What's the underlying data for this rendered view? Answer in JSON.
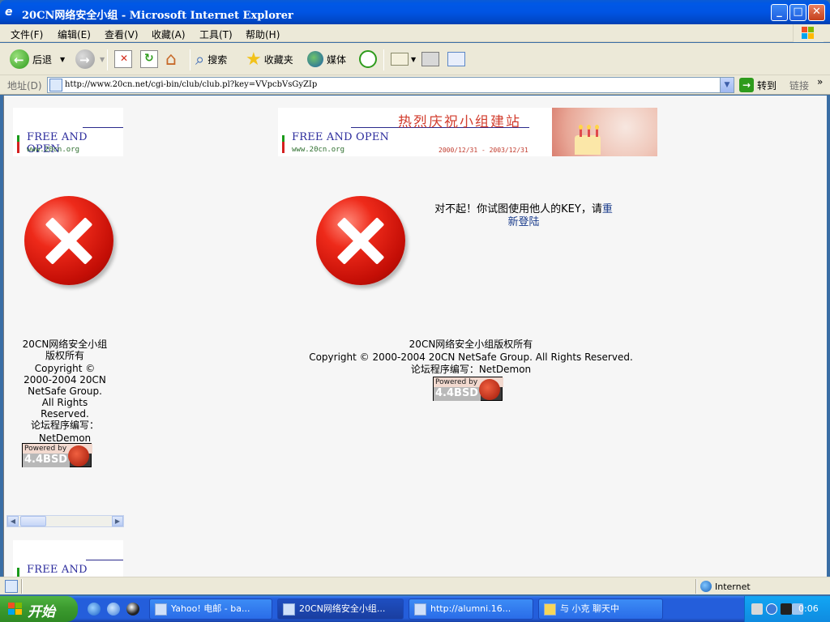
{
  "window": {
    "title": "20CN网络安全小组 - Microsoft Internet Explorer",
    "min_label": "_",
    "max_label": "□",
    "close_label": "✕"
  },
  "menu": {
    "items": [
      "文件(F)",
      "编辑(E)",
      "查看(V)",
      "收藏(A)",
      "工具(T)",
      "帮助(H)"
    ]
  },
  "toolbar": {
    "back_label": "后退",
    "search_label": "搜索",
    "favorites_label": "收藏夹",
    "media_label": "媒体"
  },
  "address": {
    "label": "地址(D)",
    "url": "http://www.20cn.net/cgi-bin/club/club.pl?key=VVpcbVsGyZIp",
    "go_label": "转到",
    "links_label": "链接",
    "links_more": "»"
  },
  "page": {
    "banner_free": "FREE AND OPEN",
    "banner_site": "www.20cn.org",
    "banner_headline": "热烈庆祝小组建站",
    "banner_dates": "2000/12/31 - 2003/12/31",
    "error_message": "对不起！你试图使用他人的KEY，请",
    "relogin_link_a": "重",
    "relogin_link_b": "新登陆",
    "footer_line1": "20CN网络安全小组版权所有",
    "footer_line2": "Copyright © 2000-2004 20CN NetSafe Group. All Rights Reserved.",
    "footer_line3": "论坛程序编写：NetDemon",
    "side_footer": [
      "20CN网络安全小组",
      "版权所有",
      "Copyright ©",
      "2000-2004 20CN",
      "NetSafe Group.",
      "All Rights",
      "Reserved.",
      "论坛程序编写：",
      "NetDemon"
    ],
    "powered_by": "Powered by",
    "powered_bsd": "4.4BSD"
  },
  "status": {
    "zone": "Internet"
  },
  "taskbar": {
    "start_label": "开始",
    "tasks": [
      "Yahoo! 电邮 - ba...",
      "20CN网络安全小组...",
      "http://alumni.16...",
      "与 小克 聊天中"
    ],
    "clock": "0:06"
  }
}
